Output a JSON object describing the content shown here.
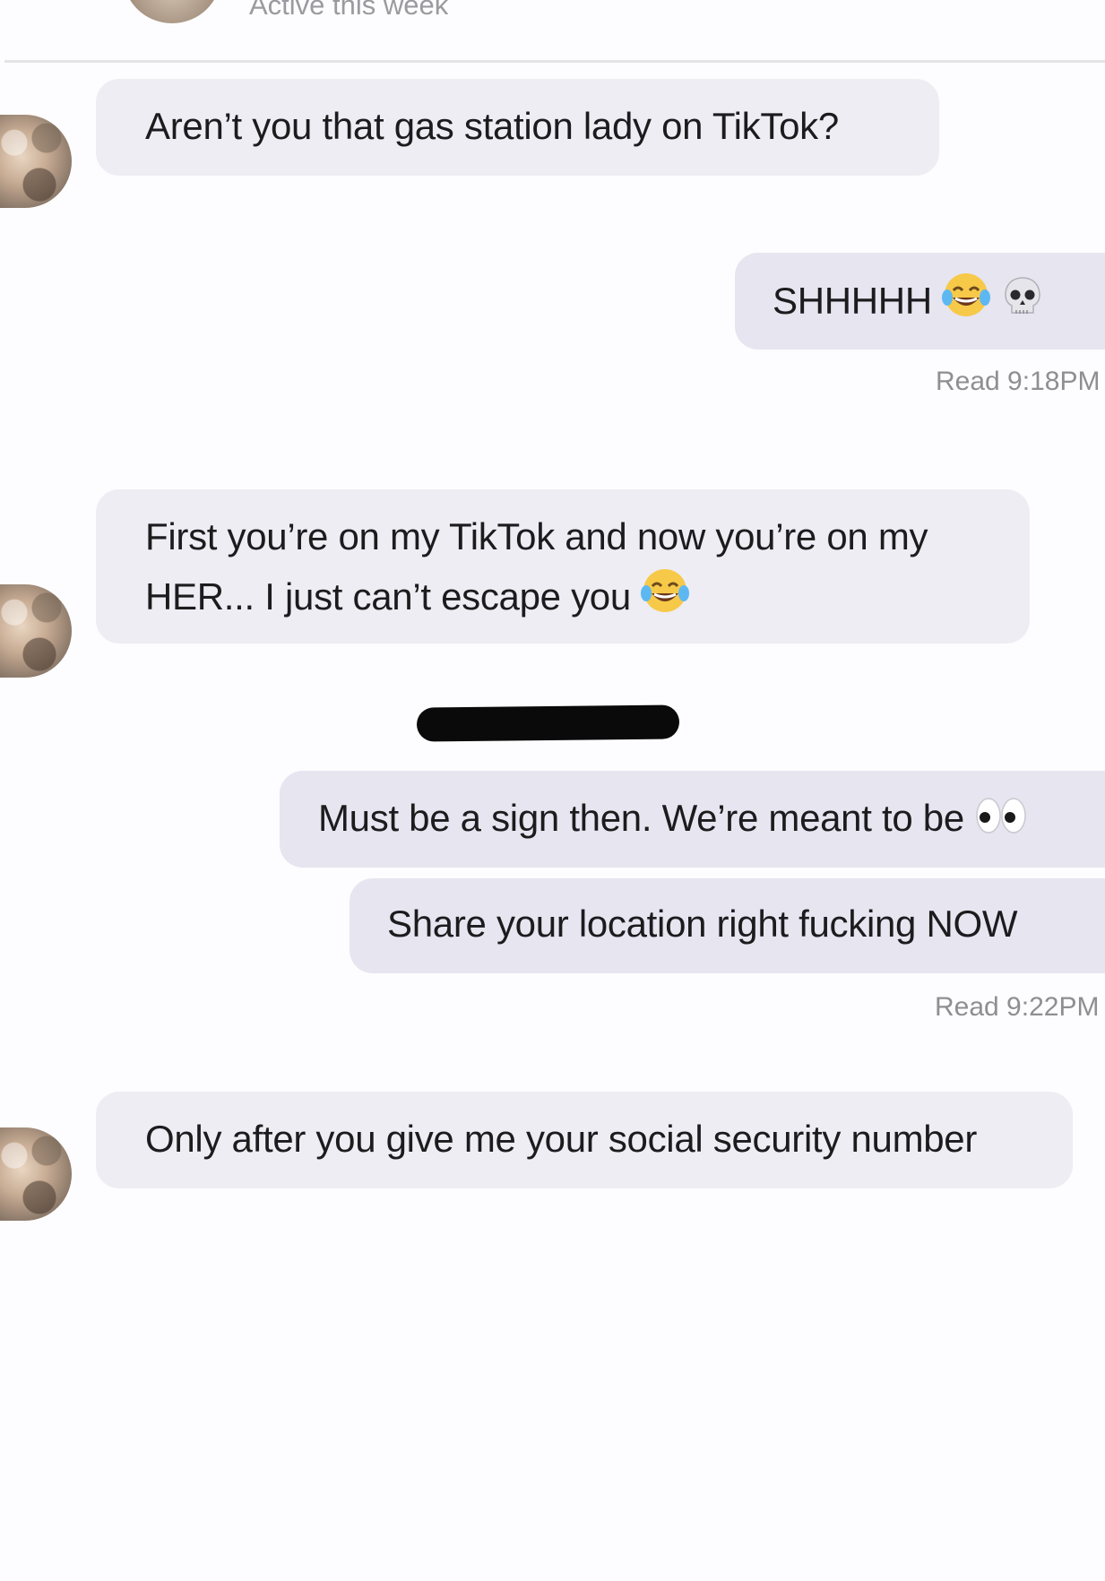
{
  "header": {
    "status": "Active this week"
  },
  "messages": [
    {
      "from": "them",
      "text": "Aren’t you that gas station lady on TikTok?"
    },
    {
      "from": "me",
      "text": "SHHHHH",
      "emojis": [
        "tears-of-joy-emoji",
        "skull-emoji"
      ]
    },
    {
      "from": "me",
      "receipt": "Read 9:18PM"
    },
    {
      "from": "them",
      "line1": "First you’re on my TikTok and now you’re on my",
      "line2": "HER... I just can’t escape you",
      "emojis": [
        "tears-of-joy-emoji"
      ]
    },
    {
      "from": "me",
      "text": "Must be a sign then. We’re meant to be",
      "emojis": [
        "eyes-emoji"
      ]
    },
    {
      "from": "me",
      "text": "Share your location right fucking NOW"
    },
    {
      "from": "me",
      "receipt": "Read 9:22PM"
    },
    {
      "from": "them",
      "text": "Only after you give me your social security number"
    }
  ],
  "colors": {
    "incoming_bubble": "#eeedf3",
    "outgoing_bubble": "#e6e5f0",
    "background": "#fdfcfe",
    "redaction": "#0a0a0a"
  }
}
